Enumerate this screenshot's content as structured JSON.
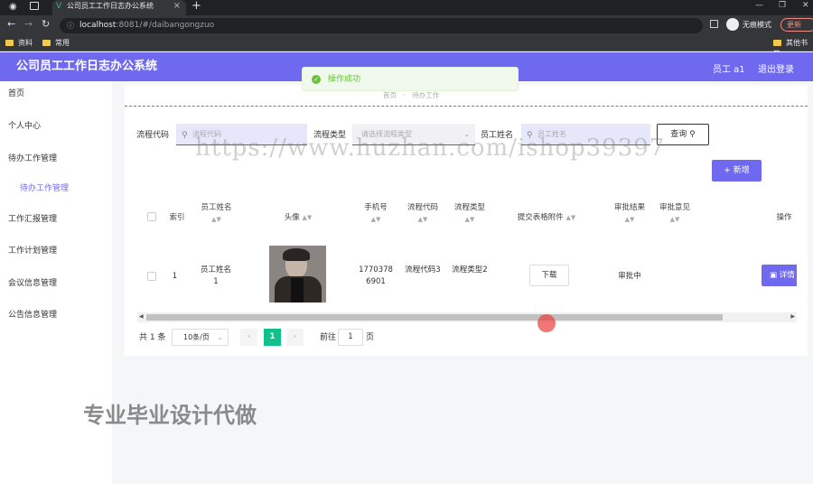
{
  "browser": {
    "tab_title": "公司员工工作日志办公系统",
    "url_host": "localhost",
    "url_path": ":8081/#/daibangongzuo",
    "incognito_label": "无痕模式",
    "update_label": "更新",
    "bookmarks": [
      "资料",
      "常用"
    ],
    "other_bookmarks": "其他书签"
  },
  "header": {
    "title": "公司员工工作日志办公系统",
    "user_label": "员工 a1",
    "logout_label": "退出登录"
  },
  "sidebar": {
    "items": [
      "首页",
      "个人中心",
      "待办工作管理",
      "待办工作管理",
      "工作汇报管理",
      "工作计划管理",
      "会议信息管理",
      "公告信息管理"
    ]
  },
  "breadcrumb": {
    "home": "首页",
    "current": "待办工作"
  },
  "toast": {
    "text": "操作成功"
  },
  "search": {
    "flow_code_label": "流程代码",
    "flow_code_placeholder": "流程代码",
    "flow_type_label": "流程类型",
    "flow_type_placeholder": "请选择流程类型",
    "employee_name_label": "员工姓名",
    "employee_name_placeholder": "员工姓名",
    "query_label": "查询"
  },
  "add_label": "+ 新增",
  "table": {
    "headers": [
      "索引",
      "员工姓名",
      "头像",
      "手机号",
      "流程代码",
      "流程类型",
      "提交表格附件",
      "审批结果",
      "审批意见",
      "操作"
    ],
    "rows": [
      {
        "index": "1",
        "name": "员工姓名1",
        "phone": "17703786901",
        "flow_code": "流程代码3",
        "flow_type": "流程类型2",
        "attachment_btn": "下载",
        "result": "审批中",
        "opinion": "",
        "action": "详情"
      }
    ]
  },
  "pagination": {
    "total": "共 1 条",
    "page_size": "10条/页",
    "current_page": "1",
    "goto_label": "前往",
    "goto_value": "1",
    "page_unit": "页"
  },
  "watermarks": {
    "url": "https://www.huzhan.com/ishop39397",
    "slogan": "专业毕业设计代做"
  }
}
